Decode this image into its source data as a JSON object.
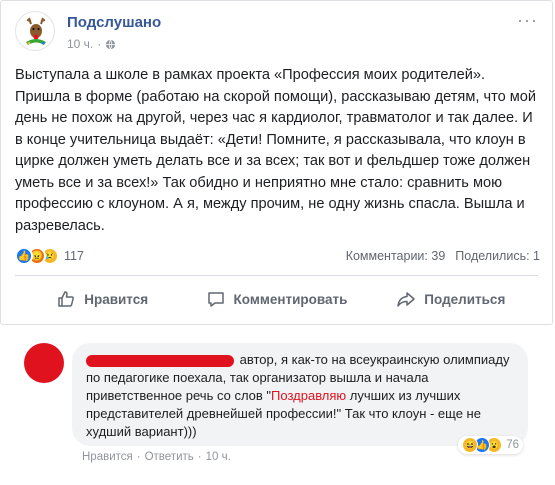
{
  "post": {
    "page_name": "Подслушано",
    "time": "10 ч.",
    "privacy_icon": "globe-icon",
    "more_icon": "more-icon",
    "text": "Выступала а школе в рамках проекта «Профессия моих родителей». Пришла в форме (работаю на скорой помощи), рассказываю детям, что мой день не похож на другой, через час я кардиолог, травматолог и так далее. И в конце учительница выдаёт: «Дети! Помните, я рассказывала, что клоун в цирке должен уметь делать все и за всех; так вот и фельдшер тоже должен уметь все и за всех!» Так обидно и неприятно мне стало: сравнить мою профессию с клоуном. А я, между прочим, не одну жизнь спасла. Вышла и разревелась.",
    "reactions": {
      "icons": [
        "like-icon",
        "angry-icon",
        "sad-icon"
      ],
      "count": "117"
    },
    "comments_stat": "Комментарии: 39",
    "shares_stat": "Поделились: 1",
    "actions": {
      "like": "Нравится",
      "comment": "Комментировать",
      "share": "Поделиться"
    }
  },
  "comment": {
    "text_part1": " автор, я как-то на всеукраинскую олимпиаду по педагогике поехала, так организатор вышла и начала приветственное речь со слов \"",
    "highlight": "Поздравляю",
    "text_part2": " лучших из лучших представителей древнейшей профессии!\" Так что клоун - еще не худший вариант)))",
    "reactions": {
      "icons": [
        "haha-icon",
        "like-icon",
        "wow-icon"
      ],
      "count": "76"
    },
    "like_label": "Нравится",
    "reply_label": "Ответить",
    "time": "10 ч.",
    "separator": "·"
  },
  "colors": {
    "link_blue": "#365899",
    "redaction_red": "#e0121e",
    "bubble_bg": "#f2f3f5"
  }
}
